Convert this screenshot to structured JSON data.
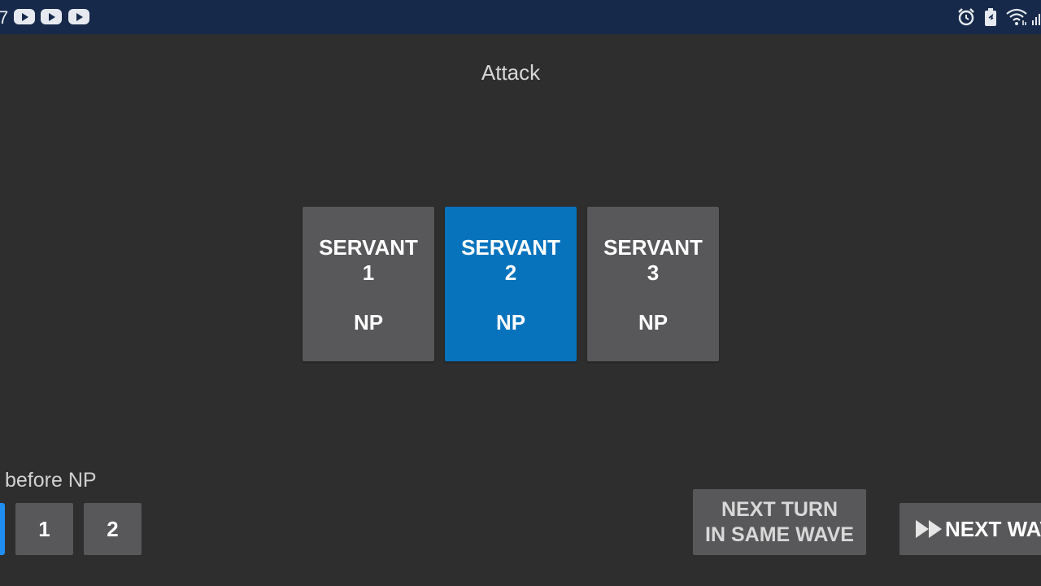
{
  "statusbar": {
    "clock_fragment": "7",
    "notification_icons": [
      "youtube-icon",
      "youtube-icon",
      "youtube-icon"
    ],
    "system_icons": [
      "alarm-icon",
      "battery-icon",
      "wifi-icon",
      "signal-icon"
    ]
  },
  "title": "Attack",
  "servants": [
    {
      "line1": "SERVANT",
      "line2": "1",
      "np": "NP",
      "selected": false
    },
    {
      "line1": "SERVANT",
      "line2": "2",
      "np": "NP",
      "selected": true
    },
    {
      "line1": "SERVANT",
      "line2": "3",
      "np": "NP",
      "selected": false
    }
  ],
  "before_np": {
    "label": "before NP",
    "options": [
      "1",
      "2"
    ]
  },
  "buttons": {
    "next_turn_line1": "NEXT TURN",
    "next_turn_line2": "IN SAME WAVE",
    "next_wave": "NEXT WAV"
  },
  "colors": {
    "background": "#2e2e2e",
    "statusbar": "#16294a",
    "tile": "#58585a",
    "selected": "#0873bd",
    "accent": "#1f8ef0"
  }
}
